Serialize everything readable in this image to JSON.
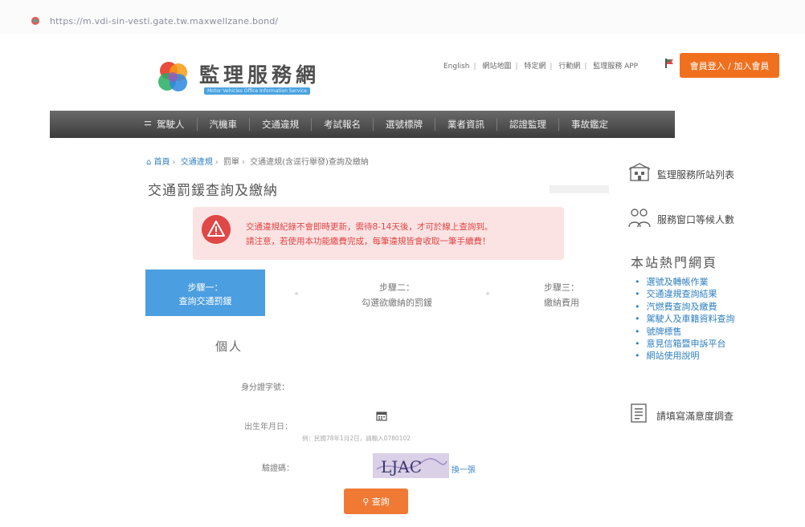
{
  "browser": {
    "url": "https://m.vdi-sin-vesti.gate.tw.maxwellzane.bond/",
    "favicon_icon": "site-favicon"
  },
  "header": {
    "logo_title": "監理服務網",
    "logo_subtitle": "Motor Vehicles Office Information Service",
    "top_links": [
      "English",
      "網站地圖",
      "特定網",
      "行動網",
      "監理服務 APP"
    ],
    "login_button": "會員登入 / 加入會員",
    "brand_color": "#f0701e"
  },
  "nav": {
    "items": [
      "駕駛人",
      "汽機車",
      "交通違規",
      "考試報名",
      "選號標牌",
      "業者資訊",
      "認證監理",
      "事故鑑定"
    ]
  },
  "breadcrumb": {
    "home": "首頁",
    "items": [
      "交通違規",
      "罰單",
      "交通違規(含逕行舉發)查詢及繳納"
    ]
  },
  "page": {
    "title": "交通罰鍰查詢及繳納"
  },
  "alert": {
    "icon": "warning-icon",
    "line1": "交通違規紀錄不會即時更新，需待8-14天後，才可於線上查詢到。",
    "line2": "請注意，若使用本功能繳費完成，每筆違規皆會收取一筆手續費！",
    "color": "#e24444"
  },
  "steps": [
    {
      "label": "步驟一：",
      "desc": "查詢交通罰鍰"
    },
    {
      "label": "步驟二：",
      "desc": "勾選欲繳納的罰鍰"
    },
    {
      "label": "步驟三：",
      "desc": "繳納費用"
    }
  ],
  "form": {
    "section_title": "個人",
    "id_label": "身分證字號：",
    "birth_label": "出生年月日：",
    "birth_hint": "例：民國78年1月2日，請輸入0780102",
    "captcha_label": "驗證碼：",
    "captcha_text": "LJAC",
    "captcha_refresh": "換一張",
    "search_button": "查詢"
  },
  "sidebar": {
    "station_list": "監理服務所站列表",
    "queue": "服務窗口等候人數",
    "hot_title": "本站熱門網頁",
    "hot_links": [
      "選號及轉帳作業",
      "交通違規查詢結果",
      "汽燃費查詢及繳費",
      "駕駛人及車籍資料查詢",
      "號牌標售",
      "意見信箱暨申訴平台",
      "網站使用說明"
    ],
    "survey": "請填寫滿意度調查"
  }
}
